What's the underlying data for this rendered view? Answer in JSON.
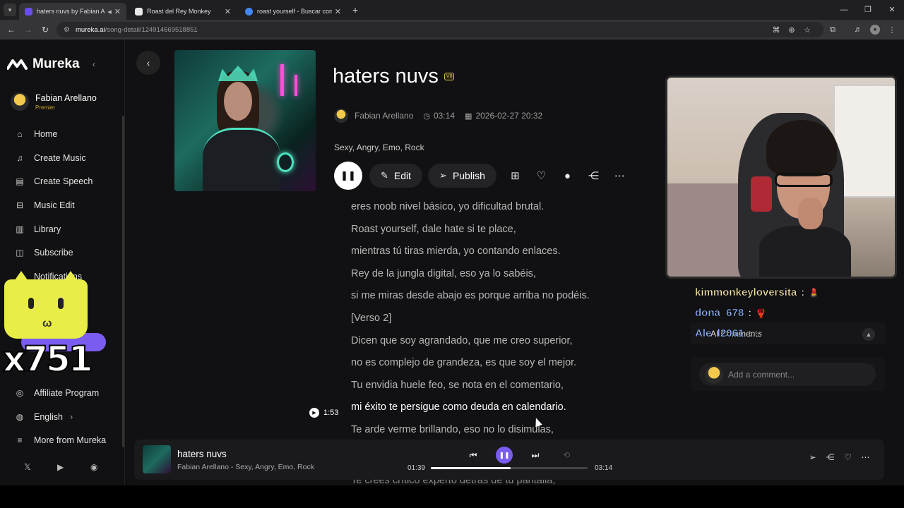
{
  "browser": {
    "tabs": [
      {
        "label": "haters nuvs by Fabian Arell",
        "active": true,
        "favicon_color": "#6b4cf0"
      },
      {
        "label": "Roast del Rey Monkey",
        "active": false,
        "favicon_color": "#e8e8e8"
      },
      {
        "label": "roast yourself - Buscar con Goo",
        "active": false,
        "favicon_color": "#4285f4"
      }
    ],
    "url_host": "mureka.ai",
    "url_path": "/song-detail/124914669518851"
  },
  "sidebar": {
    "brand": "Mureka",
    "user_name": "Fabian Arellano",
    "user_plan": "Premier",
    "nav": [
      {
        "label": "Home",
        "icon": "home-icon",
        "glyph": "⌂"
      },
      {
        "label": "Create Music",
        "icon": "music-note-icon",
        "glyph": "♫"
      },
      {
        "label": "Create Speech",
        "icon": "speech-icon",
        "glyph": "▤"
      },
      {
        "label": "Music Edit",
        "icon": "edit-icon",
        "glyph": "⊟"
      },
      {
        "label": "Library",
        "icon": "library-icon",
        "glyph": "▥"
      },
      {
        "label": "Subscribe",
        "icon": "subscribe-icon",
        "glyph": "◫"
      },
      {
        "label": "Notifications",
        "icon": "bell-icon",
        "glyph": "♢"
      }
    ],
    "nav_bottom": [
      {
        "label": "Affiliate Program",
        "icon": "affiliate-icon",
        "glyph": "◎"
      },
      {
        "label": "English",
        "icon": "globe-icon",
        "glyph": "◍"
      },
      {
        "label": "More from Mureka",
        "icon": "menu-icon",
        "glyph": "≡"
      }
    ],
    "english_chevron": "›"
  },
  "overlay": {
    "counter": "x751"
  },
  "song": {
    "title": "haters nuvs",
    "version_badge": "V8",
    "author": "Fabian Arellano",
    "duration": "03:14",
    "created": "2026-02-27 20:32",
    "tags": "Sexy, Angry, Emo, Rock",
    "edit_label": "Edit",
    "publish_label": "Publish"
  },
  "lyrics": [
    "eres noob nivel básico, yo dificultad brutal.",
    "Roast yourself, dale hate si te place,",
    "mientras tú tiras mierda, yo contando enlaces.",
    "Rey de la jungla digital, eso ya lo sabéis,",
    "si me miras desde abajo es porque arriba no podéis.",
    "[Verso 2]",
    "Dicen que soy agrandado, que me creo superior,",
    "no es complejo de grandeza, es que soy el mejor.",
    "Tu envidia huele feo, se nota en el comentario,",
    "mi éxito te persigue como deuda en calendario.",
    "Te arde verme brillando, eso no lo disimulas,"
  ],
  "lyrics_current_index": 9,
  "lyrics_current_time": "1:53",
  "lyric_tail": "Te crees crítico experto detrás de tu pantalla,",
  "player": {
    "title": "haters nuvs",
    "subtitle": "Fabian Arellano - Sexy, Angry, Emo, Rock",
    "current_time": "01:39",
    "total_time": "03:14",
    "progress": 0.51
  },
  "chat": [
    {
      "user": "kimmonkeyloversita",
      "sep": ":",
      "emote": "💄",
      "color": "yellow"
    },
    {
      "user": "dona_678",
      "sep": ":",
      "emote": "🦞",
      "color": "blue"
    },
    {
      "user": "Ale_l2061",
      "sep": ":",
      "emote": "✂",
      "color": "blue"
    }
  ],
  "ai_comments_label": "AI Comments",
  "comment_placeholder": "Add a comment..."
}
